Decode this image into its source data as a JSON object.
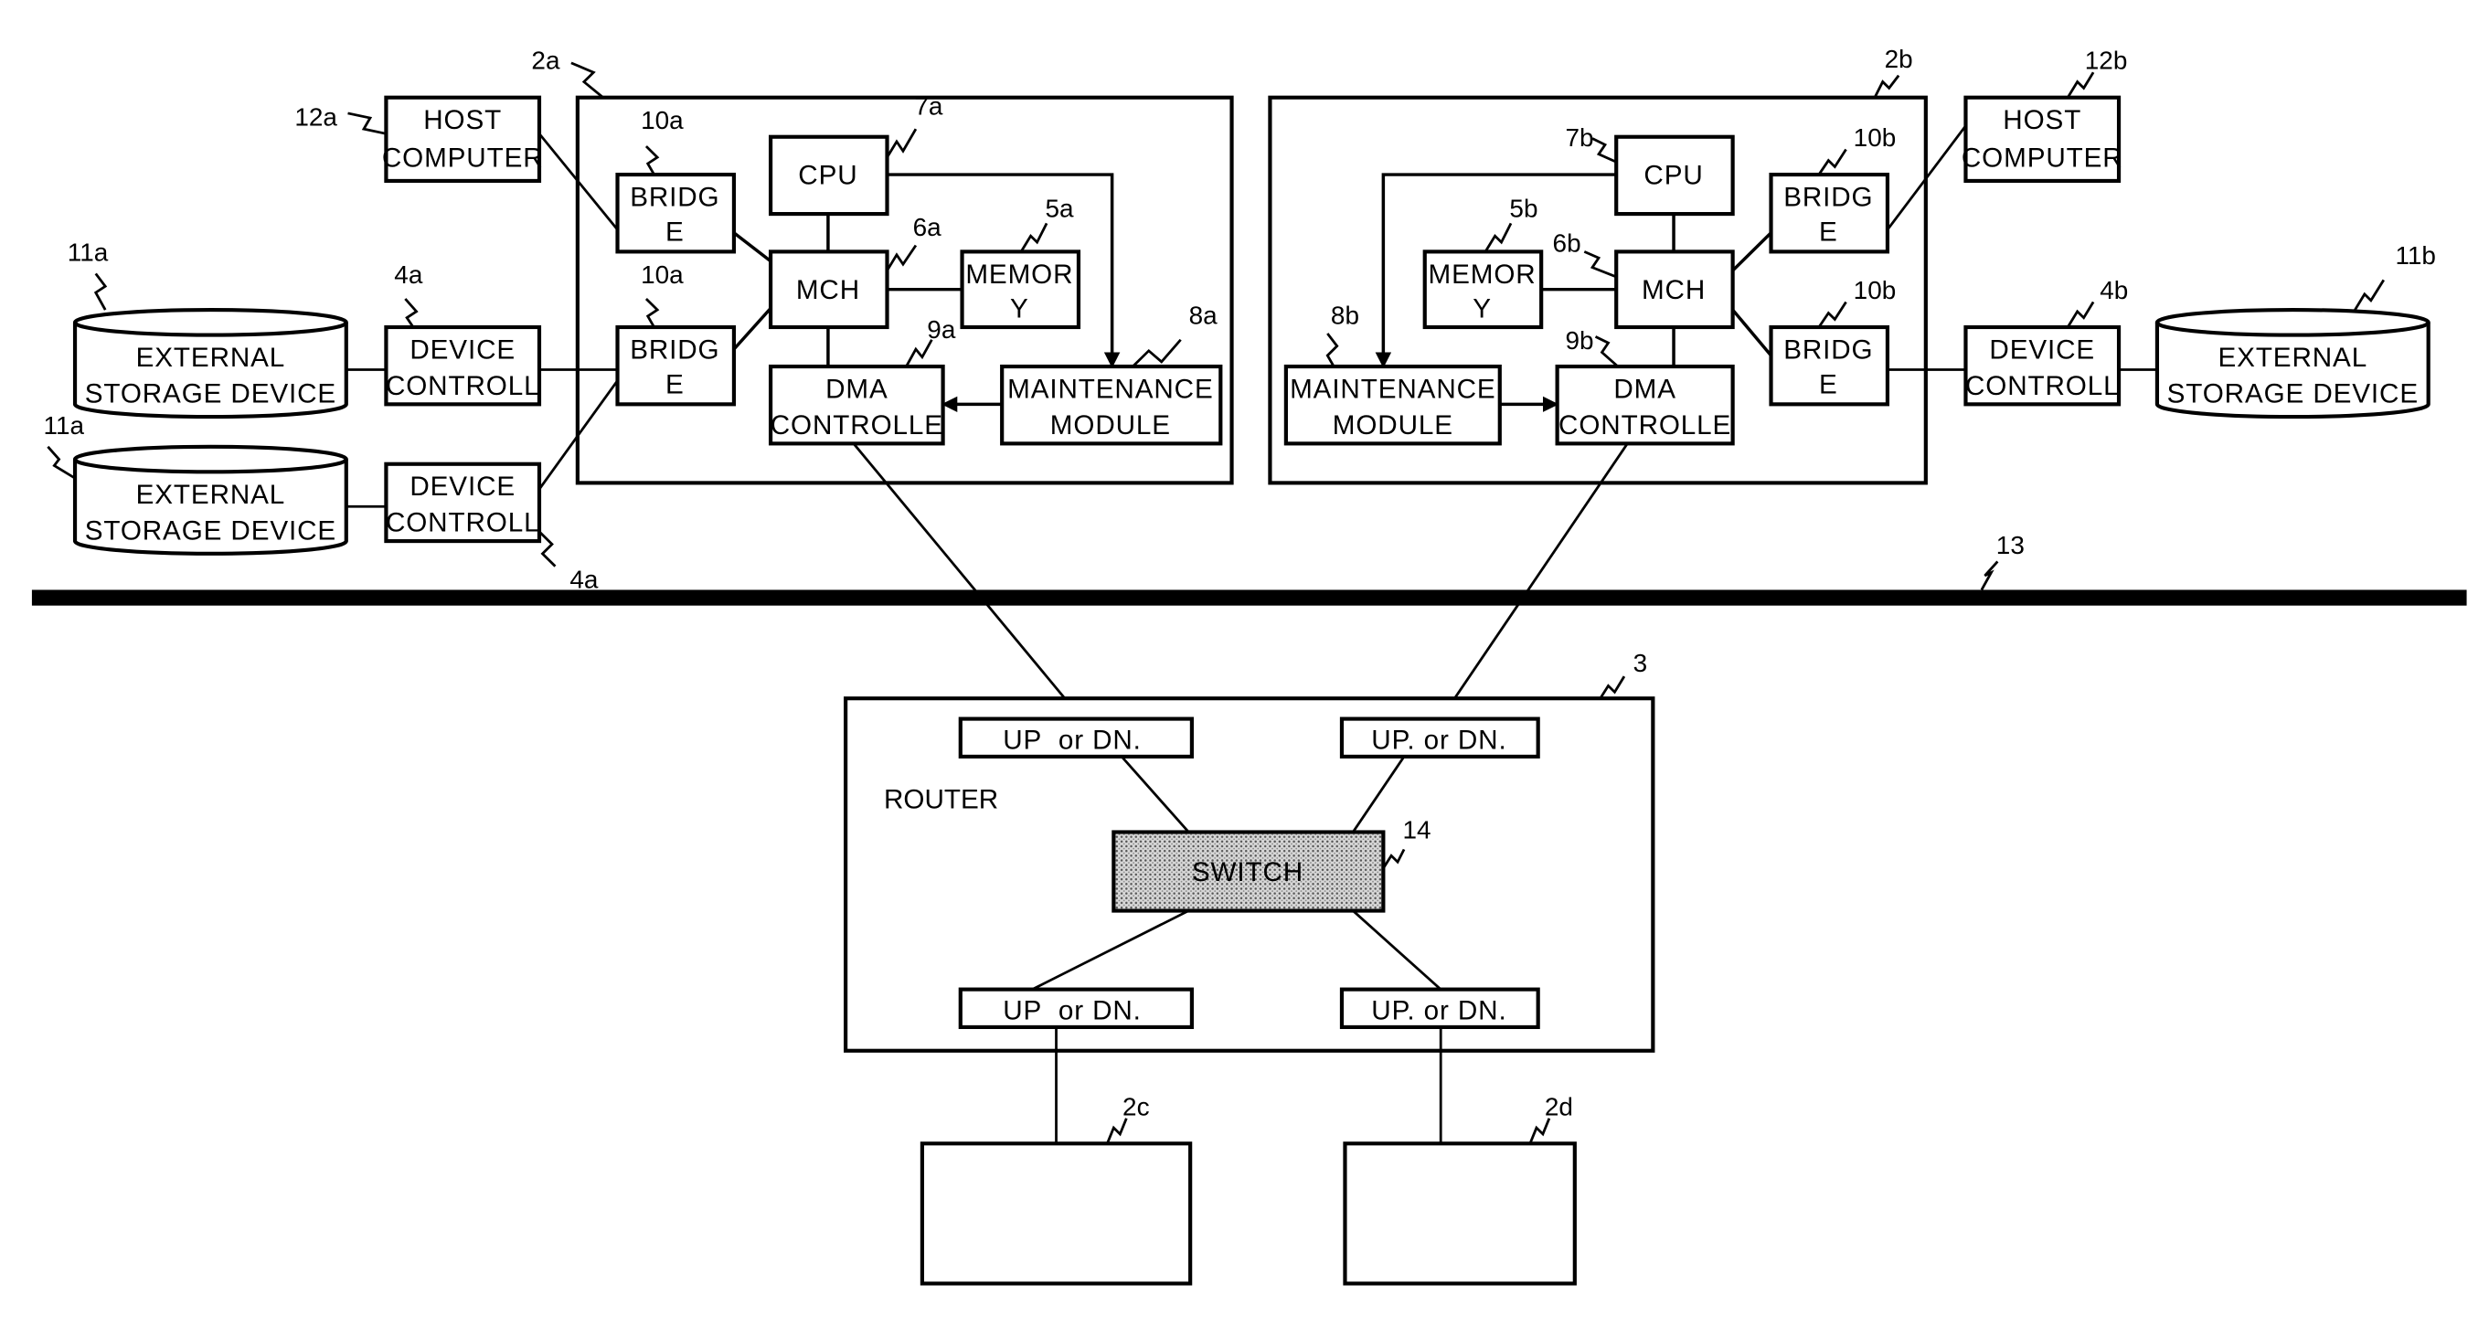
{
  "figure": {
    "bus": {
      "ref": "13"
    },
    "nodes": {
      "node_a": {
        "ref": "2a",
        "host": {
          "ref": "12a",
          "lines": [
            "HOST",
            "COMPUTER"
          ]
        },
        "bridge_top": {
          "ref": "10a",
          "lines": [
            "BRIDG",
            "E"
          ]
        },
        "bridge_bottom": {
          "ref": "10a",
          "lines": [
            "BRIDG",
            "E"
          ]
        },
        "cpu": {
          "ref": "7a",
          "lines": [
            "CPU"
          ]
        },
        "mch": {
          "ref": "6a",
          "lines": [
            "MCH"
          ]
        },
        "memory": {
          "ref": "5a",
          "lines": [
            "MEMOR",
            "Y"
          ]
        },
        "dma": {
          "ref": "9a",
          "lines": [
            "DMA",
            "CONTROLLE"
          ]
        },
        "maintenance": {
          "ref": "8a",
          "lines": [
            "MAINTENANCE",
            "MODULE"
          ]
        },
        "storage_top": {
          "ref": "11a",
          "lines": [
            "EXTERNAL",
            "STORAGE DEVICE"
          ]
        },
        "storage_bottom": {
          "ref": "11a",
          "lines": [
            "EXTERNAL",
            "STORAGE DEVICE"
          ]
        },
        "devctrl_top": {
          "ref": "4a",
          "lines": [
            "DEVICE",
            "CONTROLL"
          ]
        },
        "devctrl_bottom": {
          "ref": "4a",
          "lines": [
            "DEVICE",
            "CONTROLL"
          ]
        }
      },
      "node_b": {
        "ref": "2b",
        "host": {
          "ref": "12b",
          "lines": [
            "HOST",
            "COMPUTER"
          ]
        },
        "bridge_top": {
          "ref": "10b",
          "lines": [
            "BRIDG",
            "E"
          ]
        },
        "bridge_bottom": {
          "ref": "10b",
          "lines": [
            "BRIDG",
            "E"
          ]
        },
        "cpu": {
          "ref": "7b",
          "lines": [
            "CPU"
          ]
        },
        "mch": {
          "ref": "6b",
          "lines": [
            "MCH"
          ]
        },
        "memory": {
          "ref": "5b",
          "lines": [
            "MEMOR",
            "Y"
          ]
        },
        "dma": {
          "ref": "9b",
          "lines": [
            "DMA",
            "CONTROLLE"
          ]
        },
        "maintenance": {
          "ref": "8b",
          "lines": [
            "MAINTENANCE",
            "MODULE"
          ]
        },
        "storage": {
          "ref": "11b",
          "lines": [
            "EXTERNAL",
            "STORAGE DEVICE"
          ]
        },
        "devctrl": {
          "ref": "4b",
          "lines": [
            "DEVICE",
            "CONTROLL"
          ]
        }
      },
      "node_c": {
        "ref": "2c"
      },
      "node_d": {
        "ref": "2d"
      }
    },
    "router": {
      "ref": "3",
      "label": "ROUTER",
      "switch": {
        "ref": "14",
        "label": "SWITCH"
      },
      "ports": {
        "top_left": "UP  or DN.",
        "top_right": "UP. or DN.",
        "bottom_left": "UP  or DN.",
        "bottom_right": "UP. or DN."
      }
    }
  }
}
